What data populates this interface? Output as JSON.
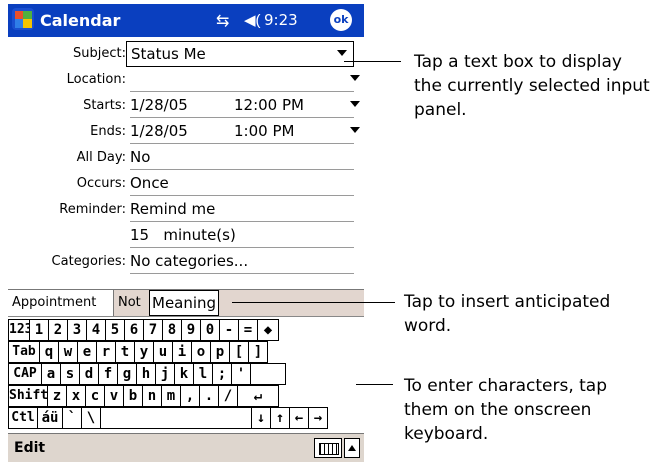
{
  "titlebar": {
    "app_title": "Calendar",
    "time": "9:23",
    "ok_label": "ok",
    "connectivity_glyph": "⇆",
    "volume_glyph": "◀("
  },
  "form": {
    "subject_label": "Subject:",
    "subject_value": "Status Me",
    "location_label": "Location:",
    "location_value": "",
    "starts_label": "Starts:",
    "starts_date": "1/28/05",
    "starts_time": "12:00 PM",
    "ends_label": "Ends:",
    "ends_date": "1/28/05",
    "ends_time": "1:00 PM",
    "allday_label": "All Day:",
    "allday_value": "No",
    "occurs_label": "Occurs:",
    "occurs_value": "Once",
    "reminder_label": "Reminder:",
    "reminder_value": "Remind me",
    "reminder_amount": "15   minute(s)",
    "categories_label": "Categories:",
    "categories_value": "No categories..."
  },
  "tabs": {
    "appointment": "Appointment",
    "notes": "Not",
    "suggestion": "Meaning"
  },
  "keyboard": {
    "row1": [
      "123",
      "1",
      "2",
      "3",
      "4",
      "5",
      "6",
      "7",
      "8",
      "9",
      "0",
      "-",
      "=",
      "◆"
    ],
    "row2": [
      "Tab",
      "q",
      "w",
      "e",
      "r",
      "t",
      "y",
      "u",
      "i",
      "o",
      "p",
      "[",
      "]"
    ],
    "row3": [
      "CAP",
      "a",
      "s",
      "d",
      "f",
      "g",
      "h",
      "j",
      "k",
      "l",
      ";",
      "'",
      ""
    ],
    "row4": [
      "Shift",
      "z",
      "x",
      "c",
      "v",
      "b",
      "n",
      "m",
      ",",
      ".",
      "/",
      "↵"
    ],
    "row5": [
      "Ctl",
      "áü",
      "`",
      "\\",
      "",
      "↓",
      "↑",
      "←",
      "→"
    ]
  },
  "menubar": {
    "edit_label": "Edit"
  },
  "callouts": {
    "text_box": "Tap a text box to display the currently selected input panel.",
    "insert_word": "Tap to insert anticipated word.",
    "enter_chars": "To enter characters, tap them on the onscreen keyboard."
  },
  "colors": {
    "titlebar": "#0a3fbf",
    "menubar": "#ded6ce",
    "tabs": "#e2d6cf"
  }
}
